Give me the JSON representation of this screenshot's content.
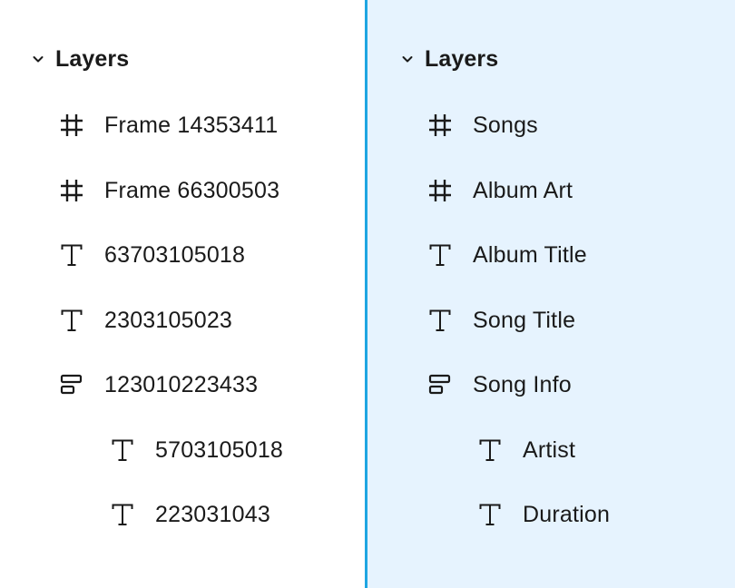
{
  "panels": [
    {
      "header": {
        "title": "Layers",
        "icon": "chevron-down-icon",
        "expanded": true
      },
      "layers": [
        {
          "name": "Frame 14353411",
          "icon": "frame-icon",
          "depth": 0
        },
        {
          "name": "Frame 66300503",
          "icon": "frame-icon",
          "depth": 0
        },
        {
          "name": "63703105018",
          "icon": "text-icon",
          "depth": 0
        },
        {
          "name": "2303105023",
          "icon": "text-icon",
          "depth": 0
        },
        {
          "name": "123010223433",
          "icon": "auto-layout-icon",
          "depth": 0
        },
        {
          "name": "5703105018",
          "icon": "text-icon",
          "depth": 1
        },
        {
          "name": "223031043",
          "icon": "text-icon",
          "depth": 1
        }
      ]
    },
    {
      "header": {
        "title": "Layers",
        "icon": "chevron-down-icon",
        "expanded": true
      },
      "layers": [
        {
          "name": "Songs",
          "icon": "frame-icon",
          "depth": 0
        },
        {
          "name": "Album Art",
          "icon": "frame-icon",
          "depth": 0
        },
        {
          "name": "Album Title",
          "icon": "text-icon",
          "depth": 0
        },
        {
          "name": "Song Title",
          "icon": "text-icon",
          "depth": 0
        },
        {
          "name": "Song Info",
          "icon": "auto-layout-icon",
          "depth": 0
        },
        {
          "name": "Artist",
          "icon": "text-icon",
          "depth": 1
        },
        {
          "name": "Duration",
          "icon": "text-icon",
          "depth": 1
        }
      ]
    }
  ],
  "colors": {
    "divider": "#1ea6e2",
    "right_panel_background": "#e6f3fe",
    "text": "#1a1a1a"
  }
}
